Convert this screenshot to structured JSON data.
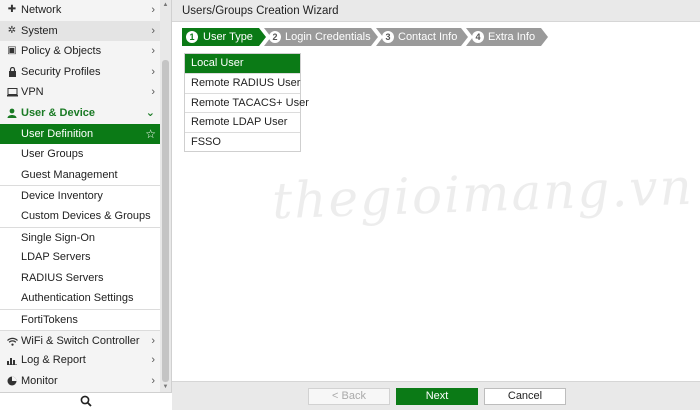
{
  "sidebar": {
    "items": [
      {
        "label": "Network",
        "icon": "network-icon",
        "glyph": "✚"
      },
      {
        "label": "System",
        "icon": "gear-icon",
        "glyph": "✲"
      },
      {
        "label": "Policy & Objects",
        "icon": "policy-icon",
        "glyph": "▣"
      },
      {
        "label": "Security Profiles",
        "icon": "lock-icon",
        "glyph": "🔒"
      },
      {
        "label": "VPN",
        "icon": "monitor-icon",
        "glyph": "▭"
      },
      {
        "label": "User & Device",
        "icon": "user-icon",
        "glyph": "👤"
      }
    ],
    "sub_items": [
      {
        "label": "User Definition"
      },
      {
        "label": "User Groups"
      },
      {
        "label": "Guest Management"
      },
      {
        "label": "Device Inventory"
      },
      {
        "label": "Custom Devices & Groups"
      },
      {
        "label": "Single Sign-On"
      },
      {
        "label": "LDAP Servers"
      },
      {
        "label": "RADIUS Servers"
      },
      {
        "label": "Authentication Settings"
      },
      {
        "label": "FortiTokens"
      }
    ],
    "bottom_items": [
      {
        "label": "WiFi & Switch Controller",
        "icon": "wifi-icon",
        "glyph": "📶"
      },
      {
        "label": "Log & Report",
        "icon": "chart-icon",
        "glyph": "▥"
      },
      {
        "label": "Monitor",
        "icon": "pie-icon",
        "glyph": "◕"
      }
    ]
  },
  "wizard": {
    "title": "Users/Groups Creation Wizard",
    "steps": [
      {
        "num": "1",
        "label": "User Type"
      },
      {
        "num": "2",
        "label": "Login Credentials"
      },
      {
        "num": "3",
        "label": "Contact Info"
      },
      {
        "num": "4",
        "label": "Extra Info"
      }
    ],
    "user_types": [
      {
        "label": "Local User"
      },
      {
        "label": "Remote RADIUS User"
      },
      {
        "label": "Remote TACACS+ User"
      },
      {
        "label": "Remote LDAP User"
      },
      {
        "label": "FSSO"
      }
    ]
  },
  "footer": {
    "back_label": "< Back",
    "next_label": "Next",
    "cancel_label": "Cancel"
  },
  "watermark": "thegioimang.vn",
  "colors": {
    "accent": "#0b7a16",
    "step_inactive": "#9a9a9a"
  }
}
